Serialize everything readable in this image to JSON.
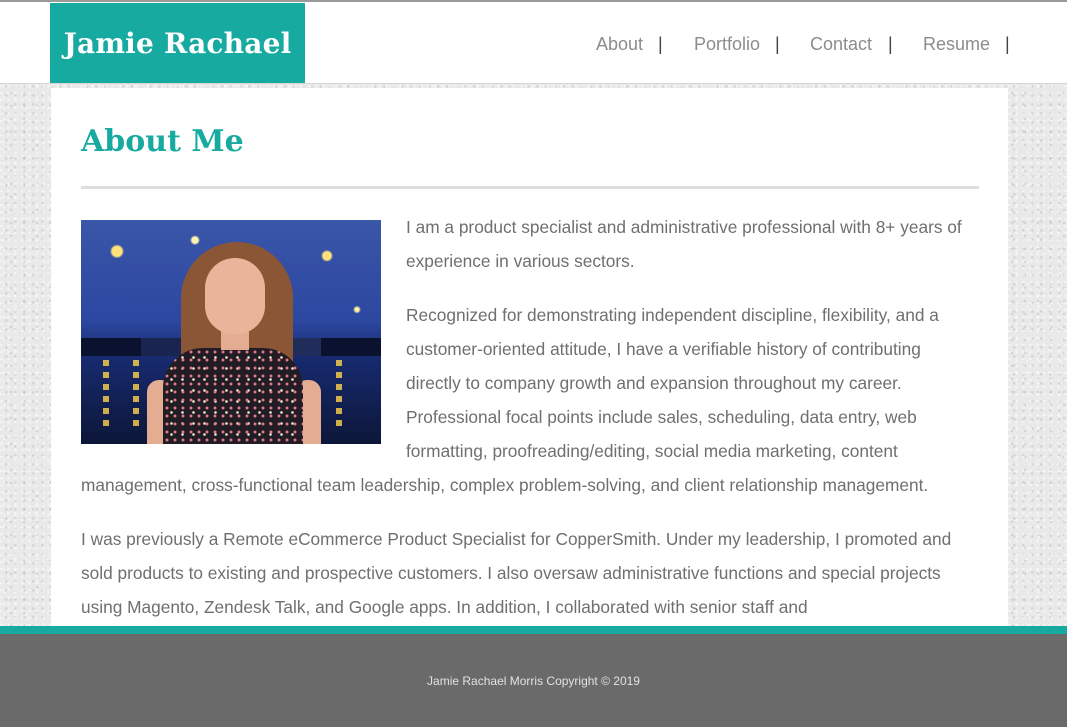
{
  "site": {
    "logo": "Jamie Rachael"
  },
  "nav": {
    "items": [
      {
        "label": "About"
      },
      {
        "label": "Portfolio"
      },
      {
        "label": "Contact"
      },
      {
        "label": "Resume"
      }
    ],
    "separator": "|"
  },
  "main": {
    "title": "About Me",
    "photo_icon": "portrait-photo",
    "paragraphs": [
      "I am a product specialist and administrative professional with 8+ years of experience in various sectors.",
      "Recognized for demonstrating independent discipline, flexibility, and a customer-oriented attitude, I have a verifiable history of contributing directly to company growth and expansion throughout my career. Professional focal points include sales, scheduling, data entry, web formatting, proofreading/editing, social media marketing, content management, cross-functional team leadership, complex problem-solving, and client relationship management.",
      "I was previously a Remote eCommerce Product Specialist for CopperSmith. Under my leadership, I promoted and sold products to existing and prospective customers. I also oversaw administrative functions and special projects using Magento, Zendesk Talk, and Google apps. In addition, I collaborated with senior staff and"
    ]
  },
  "footer": {
    "copyright": "Jamie Rachael Morris Copyright © 2019"
  },
  "colors": {
    "accent": "#17aaa0",
    "footer_bg": "#6a6a6a",
    "text": "#6f6f6f",
    "nav_text": "#8c8c8c"
  }
}
